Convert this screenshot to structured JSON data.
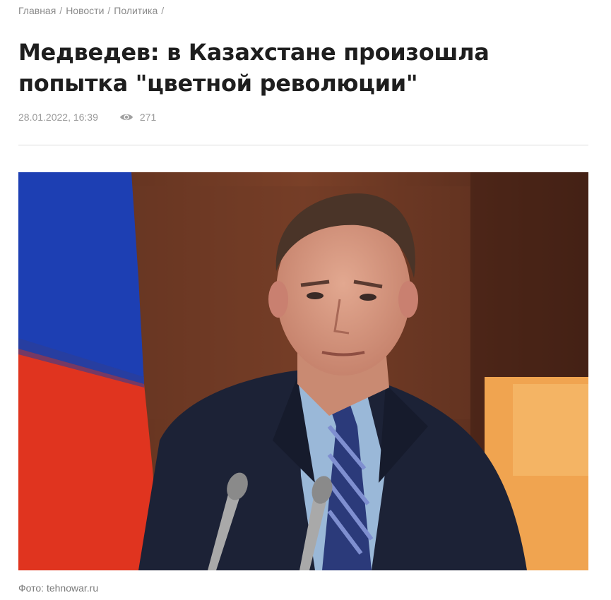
{
  "breadcrumb": {
    "items": [
      {
        "label": "Главная"
      },
      {
        "label": "Новости"
      },
      {
        "label": "Политика"
      }
    ],
    "separator": "/"
  },
  "article": {
    "title": "Медведев: в Казахстане произошла попытка \"цветной революции\"",
    "date": "28.01.2022, 16:39",
    "views": "271",
    "views_icon": "eye-icon",
    "photo_caption": "Фото: tehnowar.ru"
  },
  "colors": {
    "text_dark": "#1e1e1e",
    "muted": "#9a9a9a",
    "divider": "#dcdcdc"
  }
}
